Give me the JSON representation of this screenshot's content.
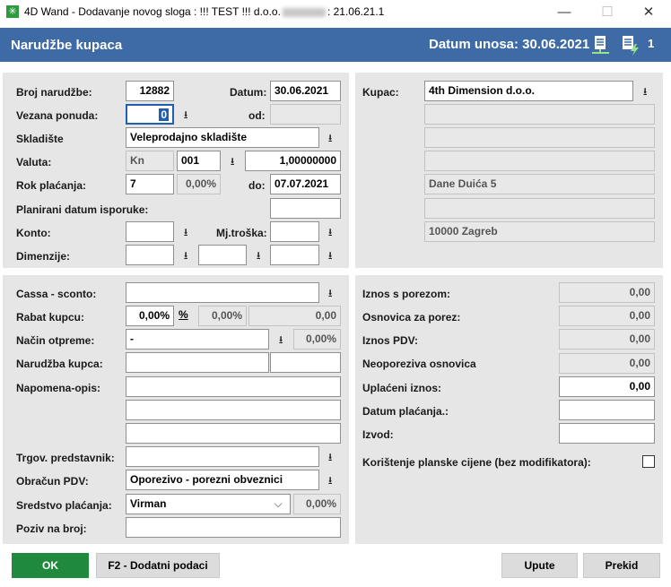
{
  "window": {
    "title_prefix": "4D Wand - Dodavanje novog sloga : !!! TEST !!! d.o.o.",
    "title_suffix": ": 21.06.21.1",
    "minimize": "—",
    "maximize": "☐",
    "close": "✕",
    "app_icon": "✳"
  },
  "header": {
    "title": "Narudžbe kupaca",
    "date_label": "Datum unosa: 30.06.2021",
    "doc_count": "1"
  },
  "order": {
    "broj_label": "Broj narudžbe:",
    "broj_value": "12882",
    "datum_label": "Datum:",
    "datum_value": "30.06.2021",
    "vezana_label": "Vezana ponuda:",
    "vezana_value": "0",
    "od_label": "od:",
    "od_value": "",
    "skladiste_label": "Skladište",
    "skladiste_value": "Veleprodajno skladište",
    "valuta_label": "Valuta:",
    "valuta_code": "Kn",
    "valuta_num": "001",
    "valuta_tecaj": "1,00000000",
    "rok_label": "Rok plaćanja:",
    "rok_value": "7",
    "rok_pct": "0,00%",
    "do_label": "do:",
    "do_value": "07.07.2021",
    "planirani_label": "Planirani datum isporuke:",
    "planirani_value": "",
    "konto_label": "Konto:",
    "konto_value": "",
    "mjtroska_label": "Mj.troška:",
    "mjtroska_value": "",
    "dimenzije_label": "Dimenzije:",
    "dim1": "",
    "dim2": "",
    "dim3": ""
  },
  "customer": {
    "kupac_label": "Kupac:",
    "kupac_value": "4th Dimension d.o.o.",
    "line2": "",
    "line3": "",
    "line4": "",
    "address": "Dane Duića 5",
    "line6": "",
    "city": "10000 Zagreb"
  },
  "details": {
    "cassa_label": "Cassa - sconto:",
    "cassa_value": "",
    "rabat_label": "Rabat kupcu:",
    "rabat_value": "0,00%",
    "rabat_pct_btn": "%",
    "rabat_pct2": "0,00%",
    "rabat_amount": "0,00",
    "nacin_label": "Način otpreme:",
    "nacin_value": "-",
    "nacin_pct": "0,00%",
    "narudzba_kupca_label": "Narudžba kupca:",
    "narudzba_kupca_1": "",
    "narudzba_kupca_2": "",
    "napomena_label": "Napomena-opis:",
    "napomena_1": "",
    "napomena_2": "",
    "napomena_3": "",
    "trgov_label": "Trgov. predstavnik:",
    "trgov_value": "",
    "obracun_label": "Obračun PDV:",
    "obracun_value": "Oporezivo - porezni obveznici",
    "sredstvo_label": "Sredstvo plaćanja:",
    "sredstvo_value": "Virman",
    "sredstvo_pct": "0,00%",
    "poziv_label": "Poziv na broj:",
    "poziv_value": ""
  },
  "totals": {
    "iznos_s_porezom_label": "Iznos s porezom:",
    "iznos_s_porezom": "0,00",
    "osnovica_label": "Osnovica za porez:",
    "osnovica": "0,00",
    "iznos_pdv_label": "Iznos PDV:",
    "iznos_pdv": "0,00",
    "neoporeziva_label": "Neoporeziva osnovica",
    "neoporeziva": "0,00",
    "uplaceni_label": "Uplaćeni iznos:",
    "uplaceni": "0,00",
    "datum_placanja_label": "Datum plaćanja.:",
    "datum_placanja": "",
    "izvod_label": "Izvod:",
    "izvod": "",
    "planske_label": "Korištenje planske cijene (bez modifikatora):"
  },
  "buttons": {
    "ok": "OK",
    "f2": "F2 - Dodatni podaci",
    "upute": "Upute",
    "prekid": "Prekid"
  },
  "icons": {
    "dropdown": "⭳",
    "combo_arrow": "⌵"
  }
}
